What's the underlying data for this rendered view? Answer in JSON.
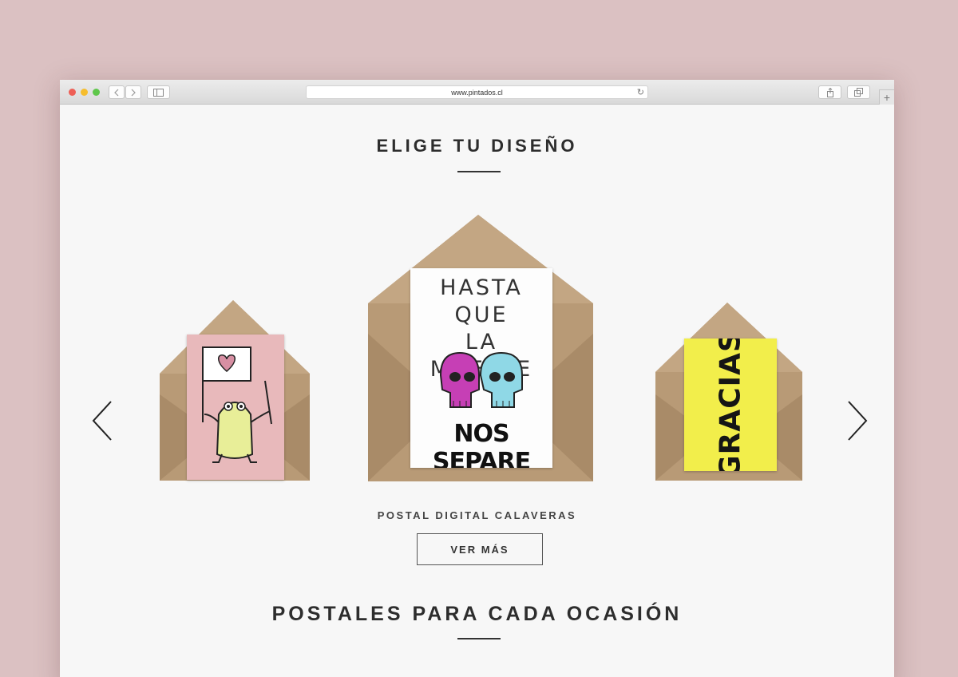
{
  "browser": {
    "url": "www.pintados.cl",
    "colors": {
      "close": "#ee5f56",
      "minimize": "#f6bd2d",
      "zoom": "#5ec74a"
    }
  },
  "page": {
    "title": "ELIGE TU DISEÑO",
    "carousel": {
      "caption": "POSTAL DIGITAL CALAVERAS",
      "cta_label": "VER MÁS",
      "prev_icon": "chevron-left-icon",
      "next_icon": "chevron-right-icon",
      "cards": [
        {
          "name": "postal-rana",
          "background": "#e8b9bb",
          "figure_color": "#e8ee98"
        },
        {
          "name": "postal-calaveras",
          "text_top": [
            "HASTA QUE",
            "LA MUERTE"
          ],
          "text_bottom": "NOS SEPARE",
          "skull_colors": [
            "#c63fb5",
            "#8fd8e6"
          ]
        },
        {
          "name": "postal-gracias",
          "text": "GRACIAS",
          "background": "#f2ee4b"
        }
      ]
    },
    "section2_title": "POSTALES PARA CADA OCASIÓN"
  },
  "colors": {
    "background": "#dbc1c2",
    "kraft": "#b89a76"
  }
}
